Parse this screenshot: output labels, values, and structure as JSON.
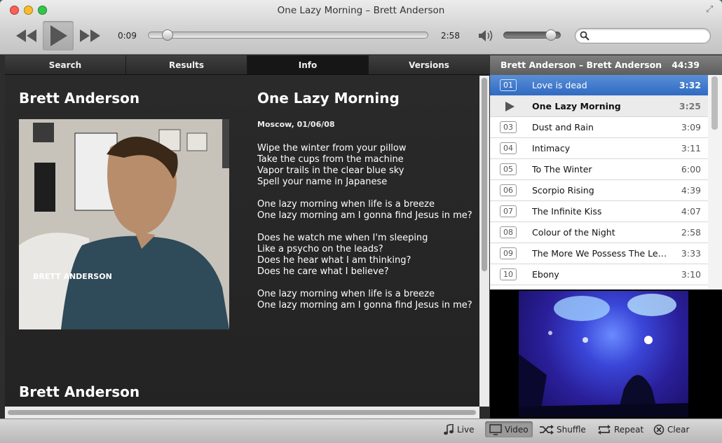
{
  "window": {
    "title": "One Lazy Morning – Brett Anderson"
  },
  "player": {
    "elapsed": "0:09",
    "total": "2:58",
    "progress_fraction": 0.05,
    "volume_fraction": 0.92,
    "search_value": "",
    "search_placeholder": ""
  },
  "tabs": [
    {
      "label": "Search",
      "active": false
    },
    {
      "label": "Results",
      "active": false
    },
    {
      "label": "Info",
      "active": true
    },
    {
      "label": "Versions",
      "active": false
    }
  ],
  "info": {
    "artist": "Brett Anderson",
    "cover_label": "BRETT ANDERSON",
    "song_title": "One Lazy Morning",
    "song_meta": "Moscow, 01/06/08",
    "lyrics": [
      [
        "Wipe the winter from your pillow",
        "Take the cups from the machine",
        "Vapor trails in the clear blue sky",
        "Spell your name in Japanese"
      ],
      [
        "One lazy morning when life is a breeze",
        "One lazy morning am I gonna find Jesus in me?"
      ],
      [
        "Does he watch me when I'm sleeping",
        "Like a psycho on the leads?",
        "Does he hear what I am thinking?",
        "Does he care what I believe?"
      ],
      [
        "One lazy morning when life is a breeze",
        "One lazy morning am I gonna find Jesus in me?"
      ]
    ],
    "artist_footer": "Brett Anderson"
  },
  "playlist": {
    "title": "Brett Anderson – Brett Anderson",
    "total": "44:39",
    "tracks": [
      {
        "num": "01",
        "name": "Love is dead",
        "dur": "3:32",
        "state": "selected"
      },
      {
        "num": "",
        "name": "One Lazy Morning",
        "dur": "3:25",
        "state": "playing"
      },
      {
        "num": "03",
        "name": "Dust and Rain",
        "dur": "3:09",
        "state": ""
      },
      {
        "num": "04",
        "name": "Intimacy",
        "dur": "3:11",
        "state": ""
      },
      {
        "num": "05",
        "name": "To The Winter",
        "dur": "6:00",
        "state": ""
      },
      {
        "num": "06",
        "name": "Scorpio Rising",
        "dur": "4:39",
        "state": ""
      },
      {
        "num": "07",
        "name": "The Infinite Kiss",
        "dur": "4:07",
        "state": ""
      },
      {
        "num": "08",
        "name": "Colour of the Night",
        "dur": "2:58",
        "state": ""
      },
      {
        "num": "09",
        "name": "The More We Possess The Less We Own Of Ourselves",
        "dur": "3:33",
        "state": ""
      },
      {
        "num": "10",
        "name": "Ebony",
        "dur": "3:10",
        "state": ""
      }
    ]
  },
  "bottombar": {
    "live": "Live",
    "video": "Video",
    "shuffle": "Shuffle",
    "repeat": "Repeat",
    "clear": "Clear"
  },
  "icons": {
    "prev": "rewind-icon",
    "play": "play-icon",
    "next": "fast-forward-icon",
    "volume": "speaker-icon",
    "search": "magnifier-icon",
    "live": "music-note-icon",
    "video": "monitor-icon",
    "shuffle": "shuffle-icon",
    "repeat": "repeat-icon",
    "clear": "clear-icon"
  },
  "colors": {
    "selection": "#3a74c8",
    "close": "#fc5f57",
    "minimize": "#fdbc2e",
    "zoom": "#33c748"
  }
}
